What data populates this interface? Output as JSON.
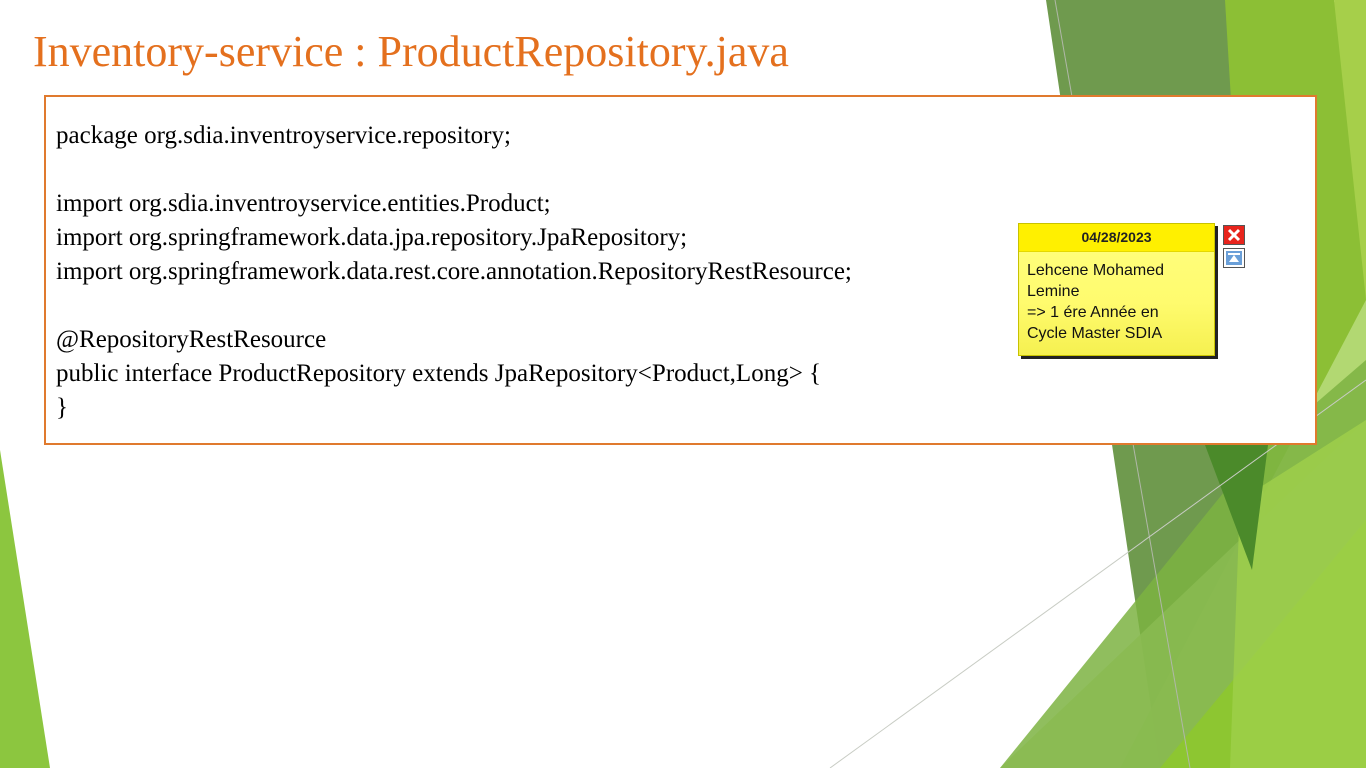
{
  "slide": {
    "title": "Inventory-service : ProductRepository.java",
    "colors": {
      "title": "#e4701e",
      "box_border": "#e07a2e",
      "accent_green": "#8cc63f",
      "sticky_yellow": "#fff000"
    }
  },
  "code": {
    "lines": [
      "package org.sdia.inventroyservice.repository;",
      "import org.sdia.inventroyservice.entities.Product;",
      "import org.springframework.data.jpa.repository.JpaRepository;",
      "import org.springframework.data.rest.core.annotation.RepositoryRestResource;",
      "@RepositoryRestResource",
      "public interface ProductRepository extends JpaRepository<Product,Long> {",
      "}"
    ]
  },
  "sticky_note": {
    "date": "04/28/2023",
    "lines": [
      "Lehcene Mohamed",
      "Lemine",
      "=> 1 ére Année en",
      "Cycle Master SDIA"
    ],
    "close_icon": "close-icon",
    "minimize_icon": "collapse-icon"
  }
}
